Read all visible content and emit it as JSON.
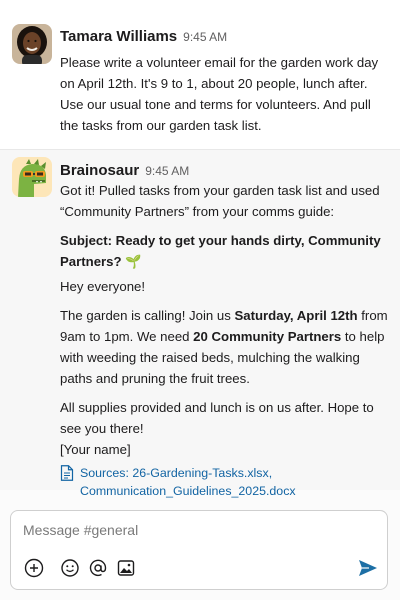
{
  "messages": [
    {
      "sender": "Tamara Williams",
      "time": "9:45 AM",
      "text": "Please write a volunteer email for the garden work day on April 12th. It's 9 to 1, about 20 people, lunch after. Use our usual tone and terms for volunteers. And pull the tasks from our garden task list."
    },
    {
      "sender": "Brainosaur",
      "time": "9:45 AM",
      "intro": "Got it! Pulled tasks from your garden task list and used “Community Partners” from your comms guide:",
      "subject": "Subject: Ready to get your hands dirty, Community Partners? 🌱",
      "greeting": "Hey everyone!",
      "para_1": "The garden is calling! Join us ",
      "para_1_bold_1": "Saturday, April 12th",
      "para_1_mid_1": " from 9am to 1pm. We need ",
      "para_1_bold_2": "20 Community Partners",
      "para_1_end": " to help with weeding the raised beds, mulching the walking paths and pruning the fruit trees.",
      "para_2": "All supplies provided and lunch is on us after. Hope to see you there!",
      "signoff": "[Your name]",
      "sources": "Sources: 26-Gardening-Tasks.xlsx, Communication_Guidelines_2025.docx"
    }
  ],
  "composer": {
    "placeholder": "Message #general"
  },
  "icons": {
    "doc": "document-icon",
    "plus": "plus-circle-icon",
    "emoji": "emoji-icon",
    "mention": "at-mention-icon",
    "image": "image-icon",
    "send": "send-icon"
  },
  "colors": {
    "link": "#1264a3",
    "send": "#1d6fa5",
    "dino": "#7cb342",
    "glasses": "#f29a1f"
  }
}
